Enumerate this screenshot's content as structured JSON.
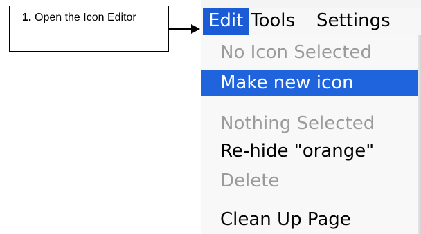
{
  "callout": {
    "step_number": "1.",
    "text": "Open the Icon Editor"
  },
  "menubar": {
    "items": [
      "Edit",
      "Tools",
      "Settings"
    ]
  },
  "menu": {
    "items": [
      {
        "label": "No Icon Selected",
        "enabled": false
      },
      {
        "label": "Make new icon",
        "enabled": true,
        "highlighted": true
      },
      {
        "label": "Nothing Selected",
        "enabled": false
      },
      {
        "label": "Re-hide \"orange\"",
        "enabled": true
      },
      {
        "label": "Delete",
        "enabled": false
      },
      {
        "label": "Clean Up Page",
        "enabled": true
      }
    ]
  },
  "colors": {
    "highlight": "#1f63dd",
    "disabled_text": "#9b9b9b"
  }
}
